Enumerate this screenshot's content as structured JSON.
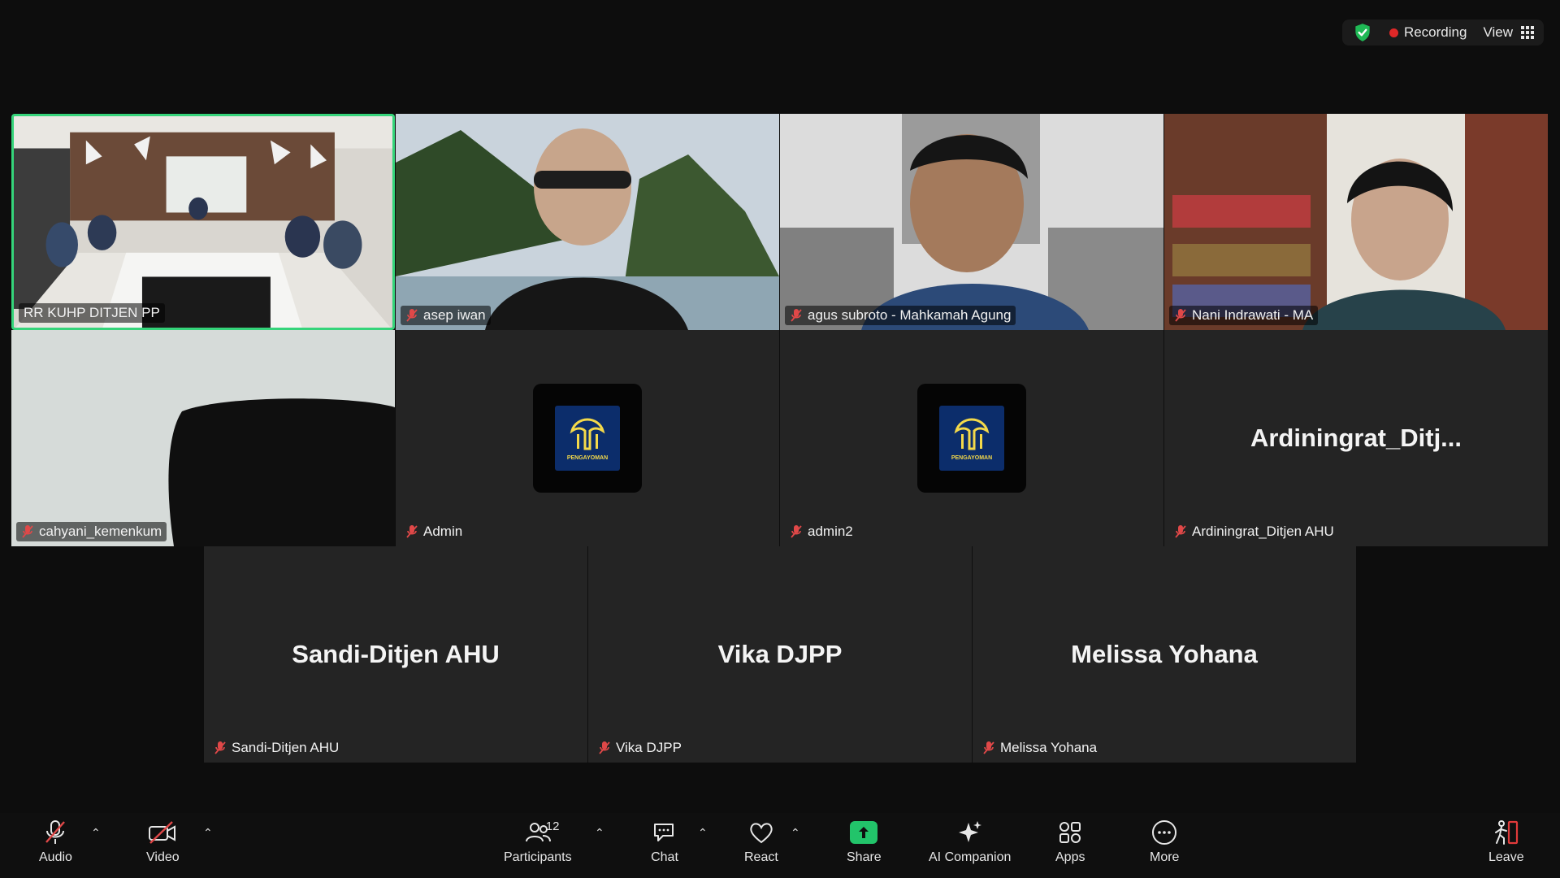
{
  "topbar": {
    "recording_label": "Recording",
    "view_label": "View",
    "security_icon": "shield-check-icon",
    "colors": {
      "shield": "#1fb955",
      "record_dot": "#e02828"
    }
  },
  "tiles": [
    {
      "name": "RR KUHP DITJEN PP",
      "kind": "video",
      "active": true,
      "muted": false
    },
    {
      "name": "asep iwan",
      "kind": "video",
      "muted": true
    },
    {
      "name": "agus subroto - Mahkamah Agung",
      "kind": "video",
      "muted": true
    },
    {
      "name": "Nani  Indrawati - MA",
      "kind": "video",
      "muted": true
    },
    {
      "name": "cahyani_kemenkum",
      "kind": "video",
      "muted": true
    },
    {
      "name": "Admin",
      "kind": "avatar",
      "avatar_text": "PENGAYOMAN",
      "muted": true
    },
    {
      "name": "admin2",
      "kind": "avatar",
      "avatar_text": "PENGAYOMAN",
      "muted": true
    },
    {
      "name": "Ardiningrat_Ditjen AHU",
      "display_name": "Ardiningrat_Ditj...",
      "kind": "name",
      "muted": true
    },
    {
      "name": "Sandi-Ditjen AHU",
      "display_name": "Sandi-Ditjen AHU",
      "kind": "name",
      "muted": true
    },
    {
      "name": "Vika DJPP",
      "display_name": "Vika DJPP",
      "kind": "name",
      "muted": true
    },
    {
      "name": "Melissa Yohana",
      "display_name": "Melissa Yohana",
      "kind": "name",
      "muted": true
    }
  ],
  "toolbar": {
    "audio_label": "Audio",
    "video_label": "Video",
    "participants_label": "Participants",
    "participants_count": "12",
    "chat_label": "Chat",
    "react_label": "React",
    "share_label": "Share",
    "ai_label": "AI Companion",
    "apps_label": "Apps",
    "more_label": "More",
    "leave_label": "Leave",
    "colors": {
      "share": "#22c46a",
      "leave": "#e03a3a",
      "muted_slash": "#e04848"
    }
  }
}
